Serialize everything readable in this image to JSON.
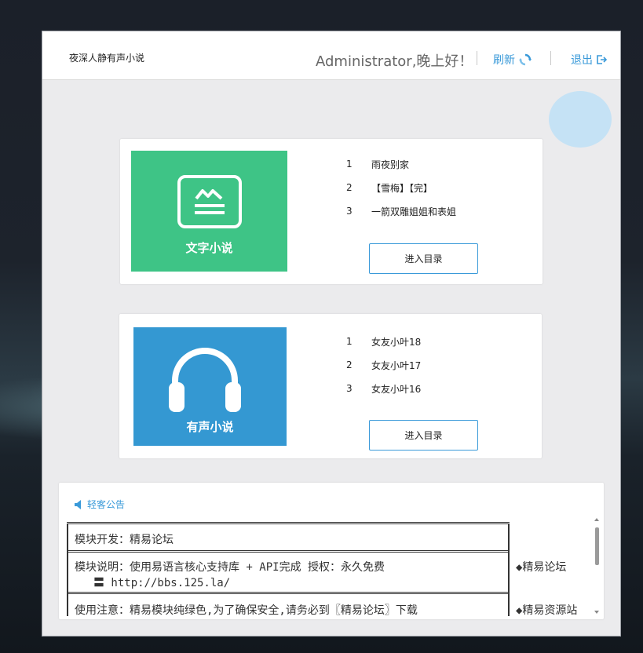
{
  "header": {
    "app_title": "夜深人静有声小说",
    "greeting": "Administrator,晚上好！",
    "refresh_label": "刷新",
    "logout_label": "退出"
  },
  "text_novel": {
    "tile_label": "文字小说",
    "items": [
      {
        "num": "1",
        "title": "雨夜别家"
      },
      {
        "num": "2",
        "title": "【雪梅】【完】"
      },
      {
        "num": "3",
        "title": "一箭双雕姐姐和表姐"
      }
    ],
    "enter_label": "进入目录",
    "tile_color": "#3ec486"
  },
  "audio_novel": {
    "tile_label": "有声小说",
    "items": [
      {
        "num": "1",
        "title": "女友小叶18"
      },
      {
        "num": "2",
        "title": "女友小叶17"
      },
      {
        "num": "3",
        "title": "女友小叶16"
      }
    ],
    "enter_label": "进入目录",
    "tile_color": "#3498d2"
  },
  "notice": {
    "title": "轻客公告",
    "lines": {
      "dev": "模块开发：精易论坛",
      "desc": "模块说明：使用易语言核心支持库 + API完成      授权：永久免费",
      "url": "〓 http://bbs.125.la/",
      "usage": "使用注意：精易模块纯绿色,为了确保安全,请务必到〖精易论坛〗下载"
    },
    "side_links": [
      "◆精易论坛",
      "◆精易资源站"
    ]
  },
  "colors": {
    "accent": "#3a9ad9",
    "bubble": "#c5e2f5"
  }
}
